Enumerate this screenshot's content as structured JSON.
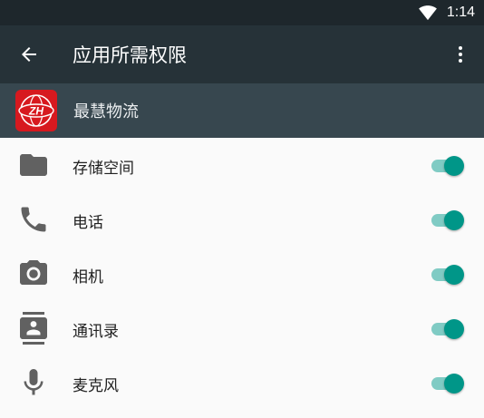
{
  "status_bar": {
    "time": "1:14",
    "wifi_icon": "wifi-icon"
  },
  "toolbar": {
    "title": "应用所需权限",
    "back_icon": "arrow-back-icon",
    "menu_icon": "more-vert-icon"
  },
  "app": {
    "name": "最慧物流",
    "logo_text": "ZH"
  },
  "permissions": [
    {
      "label": "存储空间",
      "icon": "folder-icon",
      "enabled": true
    },
    {
      "label": "电话",
      "icon": "phone-icon",
      "enabled": true
    },
    {
      "label": "相机",
      "icon": "camera-icon",
      "enabled": true
    },
    {
      "label": "通讯录",
      "icon": "contacts-icon",
      "enabled": true
    },
    {
      "label": "麦克风",
      "icon": "microphone-icon",
      "enabled": true
    }
  ],
  "colors": {
    "status_bar": "#1e272c",
    "toolbar": "#263238",
    "app_header": "#37474f",
    "accent": "#009688",
    "accent_track": "#80cbc4",
    "icon": "#616161",
    "app_logo": "#d7191f"
  }
}
